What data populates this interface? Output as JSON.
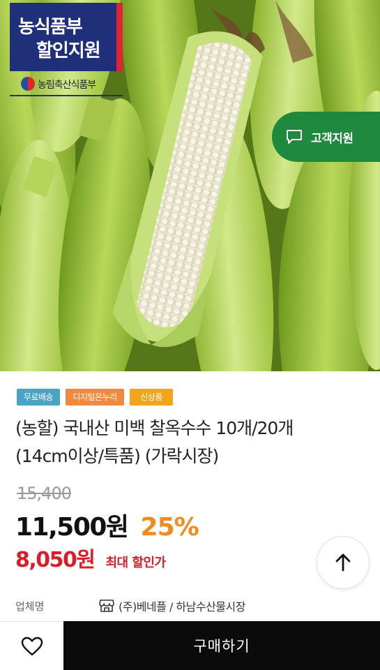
{
  "hero": {
    "badge": {
      "line1": "농식품부",
      "line2": "할인지원",
      "ministry": "농림축산식품부"
    },
    "support_button": {
      "label": "고객지원",
      "icon": "chat-icon"
    }
  },
  "product": {
    "tags": [
      {
        "label": "무료배송",
        "color": "#4aa3c4"
      },
      {
        "label": "디지털온누리",
        "color": "#ef8a3f"
      },
      {
        "label": "신상품",
        "color": "#f0a51c"
      }
    ],
    "title_line1": "(농할) 국내산 미백 찰옥수수 10개/20개",
    "title_line2": "(14cm이상/특품) (가락시장)",
    "original_price": "15,400",
    "sale_price": "11,500원",
    "discount": "25%",
    "max_price": "8,050원",
    "max_label": "최대 할인가"
  },
  "seller": {
    "key": "업체명",
    "value": "(주)베네플 / 하남수산물시장",
    "icon": "store-icon"
  },
  "bottom_bar": {
    "like_icon": "heart-icon",
    "buy_label": "구매하기"
  },
  "scroll_top": {
    "icon": "arrow-up-icon"
  },
  "colors": {
    "discount": "#f28a1c",
    "max_price": "#d81e2a",
    "support": "#1f8a3f",
    "buy": "#0b0b0b"
  }
}
